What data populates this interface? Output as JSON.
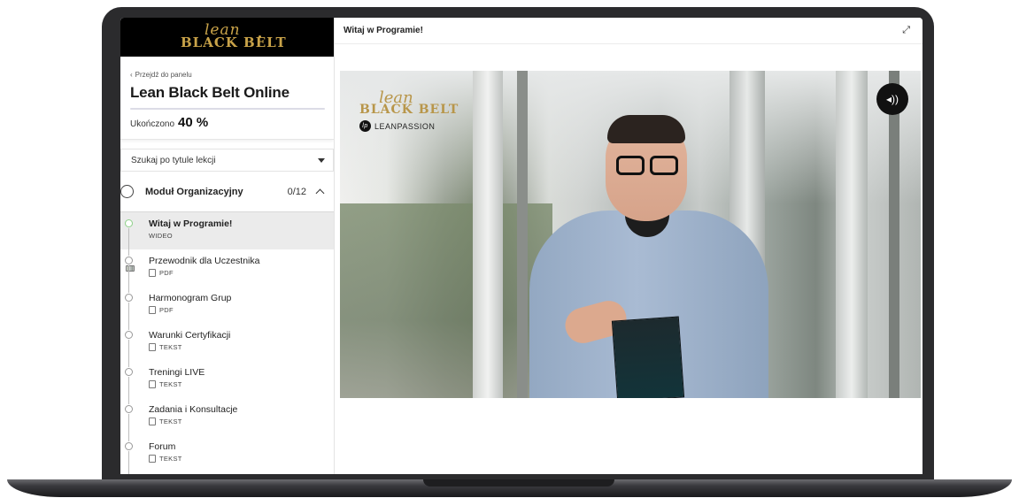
{
  "brand": {
    "logo_script": "lean",
    "logo_text": "BLACK BELT"
  },
  "sidebar": {
    "back_link": "Przejdź do panelu",
    "course_title": "Lean Black Belt Online",
    "completed_label": "Ukończono",
    "completed_value": "40 %",
    "progress_fraction": 0.0,
    "search_placeholder": "Szukaj po tytule lekcji",
    "module": {
      "title": "Moduł Organizacyjny",
      "count": "0/12"
    },
    "lessons": [
      {
        "title": "Witaj w Programie!",
        "type": "WIDEO",
        "active": true
      },
      {
        "title": "Przewodnik dla Uczestnika",
        "type": "PDF"
      },
      {
        "title": "Harmonogram Grup",
        "type": "PDF"
      },
      {
        "title": "Warunki Certyfikacji",
        "type": "TEKST"
      },
      {
        "title": "Treningi LIVE",
        "type": "TEKST"
      },
      {
        "title": "Zadania i Konsultacje",
        "type": "TEKST"
      },
      {
        "title": "Forum",
        "type": "TEKST"
      }
    ]
  },
  "main": {
    "title": "Witaj w Programie!",
    "expand_icon": "expand-icon",
    "video": {
      "logo_script": "lean",
      "logo_text": "BLACK BELT",
      "sub_brand": "LEANPASSION",
      "sound_icon": "volume-icon"
    }
  },
  "colors": {
    "gold": "#c9a349",
    "active_lesson_bg": "#ebebeb",
    "active_dot": "#8fd18a"
  }
}
